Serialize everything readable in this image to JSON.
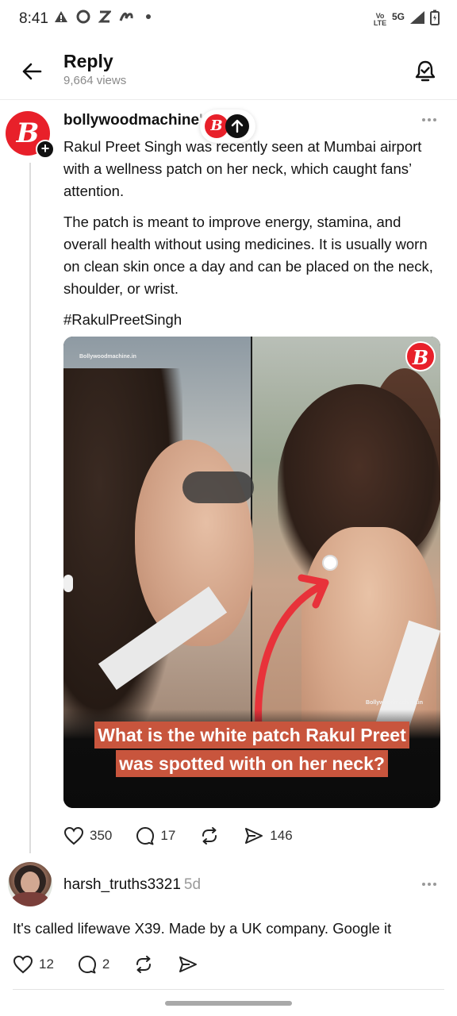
{
  "status_bar": {
    "time": "8:41",
    "network": "5G",
    "volte": "Vo LTE"
  },
  "header": {
    "title": "Reply",
    "views": "9,664 views"
  },
  "post": {
    "username": "bollywoodmachine",
    "username_suffix": "'",
    "avatar_letter": "B",
    "body": [
      "Rakul Preet Singh was recently seen at Mumbai airport with a wellness patch on her neck, which caught fans’ attention.",
      "The patch is meant to improve energy, stamina, and overall health without using medicines. It is usually worn on clean skin once a day and can be placed on the neck, shoulder, or wrist.",
      "#RakulPreetSingh"
    ],
    "image": {
      "watermark_left": "Bollywoodmachine.in",
      "watermark_right": "Bollywoodmachine.in",
      "logo_letter": "B",
      "caption_line1": "What is the white patch Rakul Preet",
      "caption_line2": "was spotted with on her neck?"
    },
    "likes": "350",
    "comments": "17",
    "shares": "146"
  },
  "reply": {
    "username": "harsh_truths3321",
    "time": "5d",
    "text": "It's called lifewave X39. Made by a UK company. Google it",
    "likes": "12",
    "comments": "2"
  },
  "colors": {
    "brand_red": "#e8202a",
    "caption_bg": "#c8553d",
    "arrow_red": "#e8323a"
  }
}
